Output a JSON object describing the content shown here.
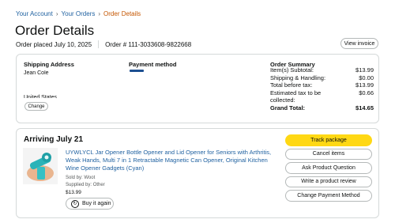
{
  "breadcrumb": {
    "your_account": "Your Account",
    "sep1": "›",
    "your_orders": "Your Orders",
    "sep2": "›",
    "order_details": "Order Details"
  },
  "page_title": "Order Details",
  "order_meta": {
    "placed": "Order placed July 10, 2025",
    "order_number": "Order # 111-3033608-9822668"
  },
  "view_invoice_label": "View invoice",
  "shipping": {
    "heading": "Shipping Address",
    "name": "Jean Cole",
    "country": "United States",
    "change_label": "Change"
  },
  "payment": {
    "heading": "Payment method",
    "icon": "card-icon"
  },
  "order_summary": {
    "heading": "Order Summary",
    "rows": [
      {
        "label": "Item(s) Subtotal:",
        "value": "$13.99"
      },
      {
        "label": "Shipping & Handling:",
        "value": "$0.00"
      },
      {
        "label": "Total before tax:",
        "value": "$13.99"
      },
      {
        "label": "Estimated tax to be collected:",
        "value": "$0.66"
      },
      {
        "label": "Grand Total:",
        "value": "$14.65"
      }
    ]
  },
  "shipment": {
    "arriving": "Arriving July 21",
    "product_title": "UYWLYCL Jar Opener Bottle Opener and Lid Opener for Seniors with Arthritis, Weak Hands, Multi 7 in 1 Retractable Magnetic Can Opener, Original Kitchen Wine Opener Gadgets (Cyan)",
    "sold_by": "Sold by: Woot",
    "supplied_by": "Supplied by: Other",
    "price": "$13.99",
    "buy_again_label": "Buy it again"
  },
  "actions": {
    "track_package": "Track package",
    "cancel_items": "Cancel items",
    "ask_question": "Ask Product Question",
    "write_review": "Write a product review",
    "change_payment": "Change Payment Method"
  },
  "colors": {
    "link": "#2162a1",
    "current_crumb": "#c45500",
    "primary_button": "#ffd814"
  }
}
